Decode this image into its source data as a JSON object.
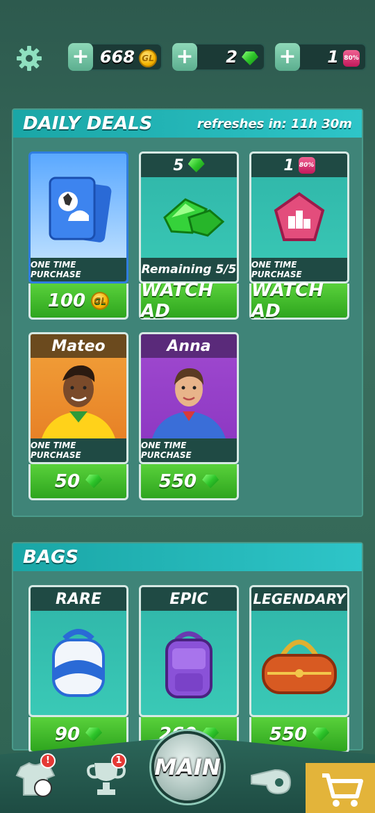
{
  "top_bar": {
    "coins": "668",
    "gems": "2",
    "tokens": "1",
    "coin_icon_label": "GL",
    "token_icon_label": "80%"
  },
  "daily_deals": {
    "title": "DAILY DEALS",
    "refresh": "refreshes in: 11h 30m",
    "cards": [
      {
        "header": "",
        "banner": "ONE TIME PURCHASE",
        "price": "100",
        "price_icon": "coin-icon"
      },
      {
        "header": "5",
        "header_icon": "gem-icon",
        "banner": "Remaining 5/5",
        "price": "WATCH AD"
      },
      {
        "header": "1",
        "header_icon": "token-icon",
        "banner": "ONE TIME PURCHASE",
        "price": "WATCH AD"
      },
      {
        "header": "Mateo",
        "banner": "ONE TIME PURCHASE",
        "price": "50",
        "price_icon": "gem-icon"
      },
      {
        "header": "Anna",
        "banner": "ONE TIME PURCHASE",
        "price": "550",
        "price_icon": "gem-icon"
      }
    ]
  },
  "bags": {
    "title": "BAGS",
    "cards": [
      {
        "header": "RARE",
        "price": "90",
        "price_icon": "gem-icon"
      },
      {
        "header": "EPIC",
        "price": "260",
        "price_icon": "gem-icon"
      },
      {
        "header": "LEGENDARY",
        "price": "550",
        "price_icon": "gem-icon"
      }
    ]
  },
  "nav": {
    "main_label": "MAIN",
    "team_badge": "!",
    "trophy_badge": "1"
  },
  "colors": {
    "accent_green": "#2ea51e",
    "header_teal": "#1aa6a6",
    "shop_active": "#e3b43a"
  }
}
